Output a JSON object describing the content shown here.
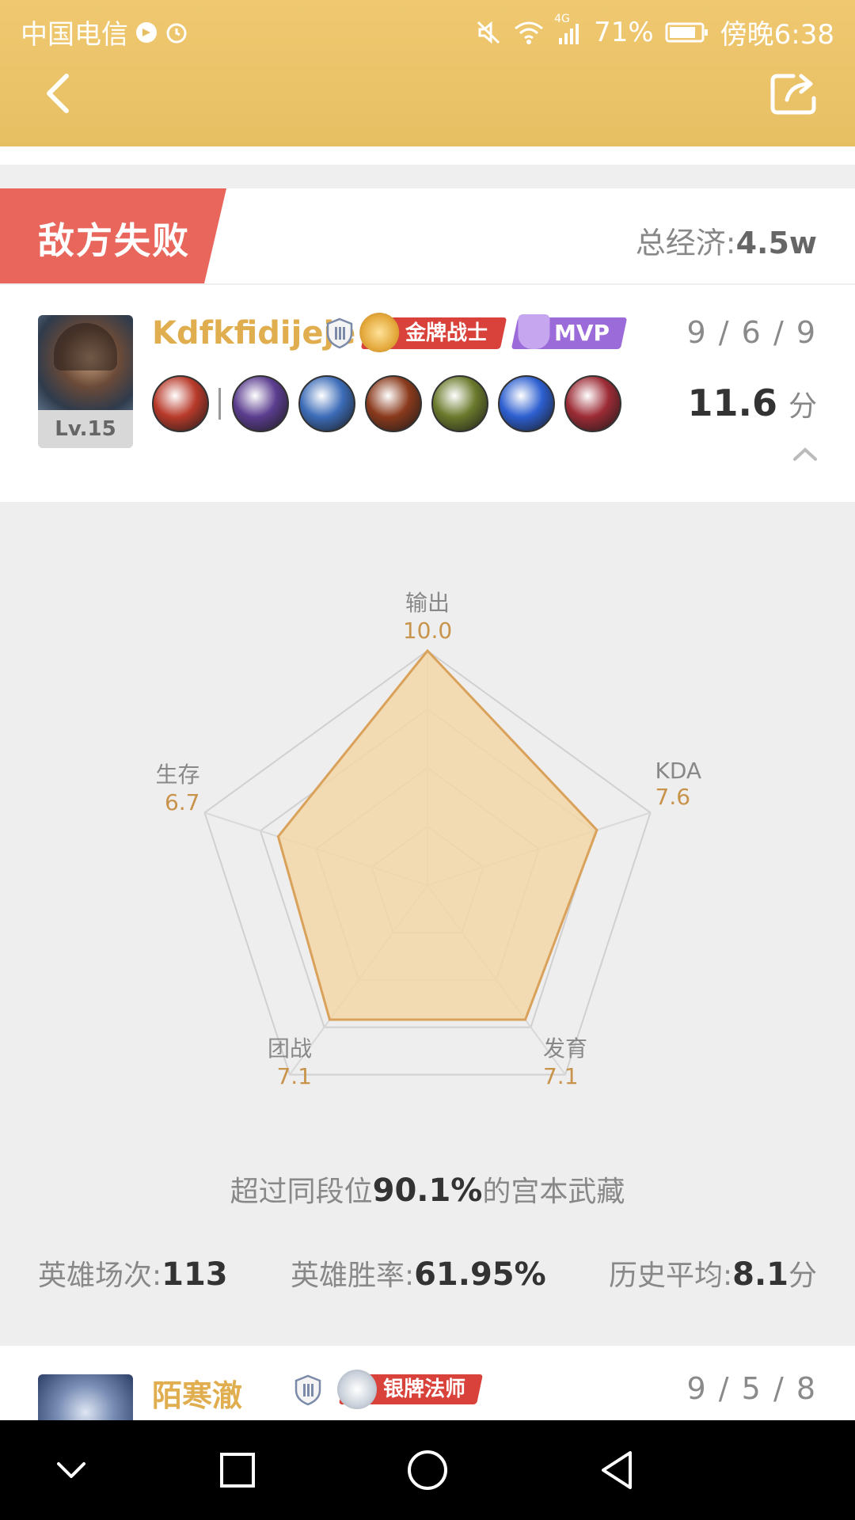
{
  "status_bar": {
    "carrier": "中国电信",
    "network": "4G",
    "battery": "71%",
    "time": "傍晚6:38"
  },
  "result": {
    "label": "敌方失败",
    "economy_label": "总经济:",
    "economy_value": "4.5w"
  },
  "player": {
    "name": "Kdfkfidijeje",
    "level": "Lv.15",
    "badge_title": "金牌战士",
    "mvp_label": "MVP",
    "kda": "9 / 6 / 9",
    "score": "11.6",
    "score_unit": "分",
    "items": [
      {
        "name": "summoner-spell",
        "color": "#b83a2a"
      },
      {
        "name": "item-1",
        "color": "#5b3d8f"
      },
      {
        "name": "item-2",
        "color": "#3c6cb8"
      },
      {
        "name": "item-3",
        "color": "#8a3a1c"
      },
      {
        "name": "item-4",
        "color": "#6a7a2c"
      },
      {
        "name": "item-5",
        "color": "#2d5fd0"
      },
      {
        "name": "item-6",
        "color": "#9c2b35"
      }
    ]
  },
  "chart_data": {
    "type": "radar",
    "max": 10,
    "axes": [
      "输出",
      "KDA",
      "发育",
      "团战",
      "生存"
    ],
    "values": [
      "10.0",
      "7.6",
      "7.1",
      "7.1",
      "6.7"
    ]
  },
  "summary": {
    "prefix": "超过同段位",
    "percent": "90.1%",
    "suffix": "的宫本武藏"
  },
  "stats": {
    "games_label": "英雄场次:",
    "games_value": "113",
    "winrate_label": "英雄胜率:",
    "winrate_value": "61.95%",
    "history_label": "历史平均:",
    "history_value": "8.1",
    "history_unit": "分"
  },
  "next_player": {
    "name": "陌寒澈",
    "badge_title": "银牌法师",
    "kda": "9 / 5 / 8"
  },
  "colors": {
    "header": "#e7bf63",
    "result_tag": "#e8665c",
    "radar_fill": "#f2d7a8",
    "radar_stroke": "#d9a15a",
    "name_gold": "#e0ad4f"
  }
}
